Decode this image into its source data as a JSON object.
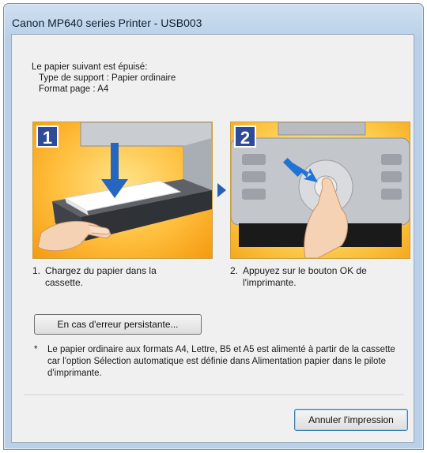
{
  "window": {
    "title": "Canon MP640 series Printer - USB003"
  },
  "message": {
    "line1": "Le papier suivant est épuisé:",
    "line2": "Type de support : Papier ordinaire",
    "line3": "Format page : A4"
  },
  "steps": [
    {
      "number": "1",
      "num_label": "1.",
      "text": "Chargez du papier dans la cassette."
    },
    {
      "number": "2",
      "num_label": "2.",
      "text": "Appuyez sur le bouton OK de l'imprimante."
    }
  ],
  "buttons": {
    "persistent_error": "En cas d'erreur persistante...",
    "cancel_print": "Annuler l'impression"
  },
  "note": {
    "star": "*",
    "text": "Le papier ordinaire aux formats A4, Lettre, B5 et A5 est alimenté à partir de la cassette car l'option Sélection automatique est définie dans Alimentation papier dans le pilote d'imprimante."
  },
  "colors": {
    "step_badge": "#2e4a9a",
    "arrow": "#2a5fb0",
    "panel_orange": "#f49a10"
  }
}
